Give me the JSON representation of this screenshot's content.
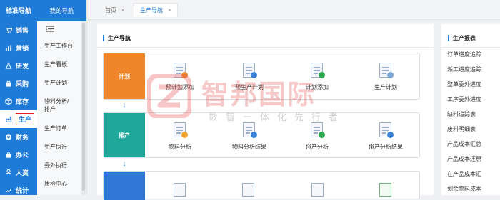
{
  "rail": {
    "title": "标准导航",
    "items": [
      {
        "label": "销售",
        "icon": "cart-icon"
      },
      {
        "label": "营销",
        "icon": "chart-icon"
      },
      {
        "label": "研发",
        "icon": "flask-icon"
      },
      {
        "label": "采购",
        "icon": "bag-icon"
      },
      {
        "label": "库存",
        "icon": "box-icon"
      },
      {
        "label": "生产",
        "icon": "factory-icon"
      },
      {
        "label": "财务",
        "icon": "money-icon"
      },
      {
        "label": "办公",
        "icon": "briefcase-icon"
      },
      {
        "label": "人资",
        "icon": "person-icon"
      },
      {
        "label": "统计",
        "icon": "stats-icon"
      }
    ],
    "active_index": 5
  },
  "nav2": {
    "title": "我的导航",
    "items": [
      "生产工作台",
      "生产看板",
      "生产计划",
      "物料分析/排产",
      "生产订单",
      "生产执行",
      "委外执行",
      "质检中心"
    ]
  },
  "tabs": [
    {
      "label": "首页",
      "close": "×"
    },
    {
      "label": "生产导航",
      "close": "×"
    }
  ],
  "main": {
    "section_title": "生产导航",
    "stages": [
      {
        "label": "计划",
        "color": "#f0862c"
      },
      {
        "label": "排产",
        "color": "#1fa89a"
      },
      {
        "label": "",
        "color": "#2f78d8"
      }
    ],
    "rows": [
      [
        {
          "label": "预计划添加",
          "icon": "doc-user-icon"
        },
        {
          "label": "预生产计划",
          "icon": "doc-edit-icon"
        },
        {
          "label": "计划添加",
          "icon": "doc-add-icon"
        },
        {
          "label": "生产计划",
          "icon": "doc-search-icon"
        }
      ],
      [
        {
          "label": "物料分析",
          "icon": "doc-chart-icon"
        },
        {
          "label": "物料分析结果",
          "icon": "doc-table-icon"
        },
        {
          "label": "排产分析",
          "icon": "doc-clock-icon"
        },
        {
          "label": "排产分析结果",
          "icon": "doc-grid-icon"
        }
      ]
    ],
    "arrow_glyph": "↓"
  },
  "reports": {
    "title": "生产报表",
    "items": [
      "订单进度追踪",
      "派工进度追踪",
      "整单委外进度",
      "工序委外进度",
      "缺料追踪表",
      "废料明细表",
      "产品成本汇总",
      "产品成本还原",
      "在产品成本汇",
      "剩余物料成本"
    ]
  },
  "watermark": {
    "main": "智邦国际",
    "sub": "数智一体化先行者"
  },
  "colors": {
    "accent": "#1f7bd8",
    "plan": "#f0862c",
    "schedule": "#1fa89a",
    "exec": "#2f78d8",
    "highlight": "#e02020"
  }
}
